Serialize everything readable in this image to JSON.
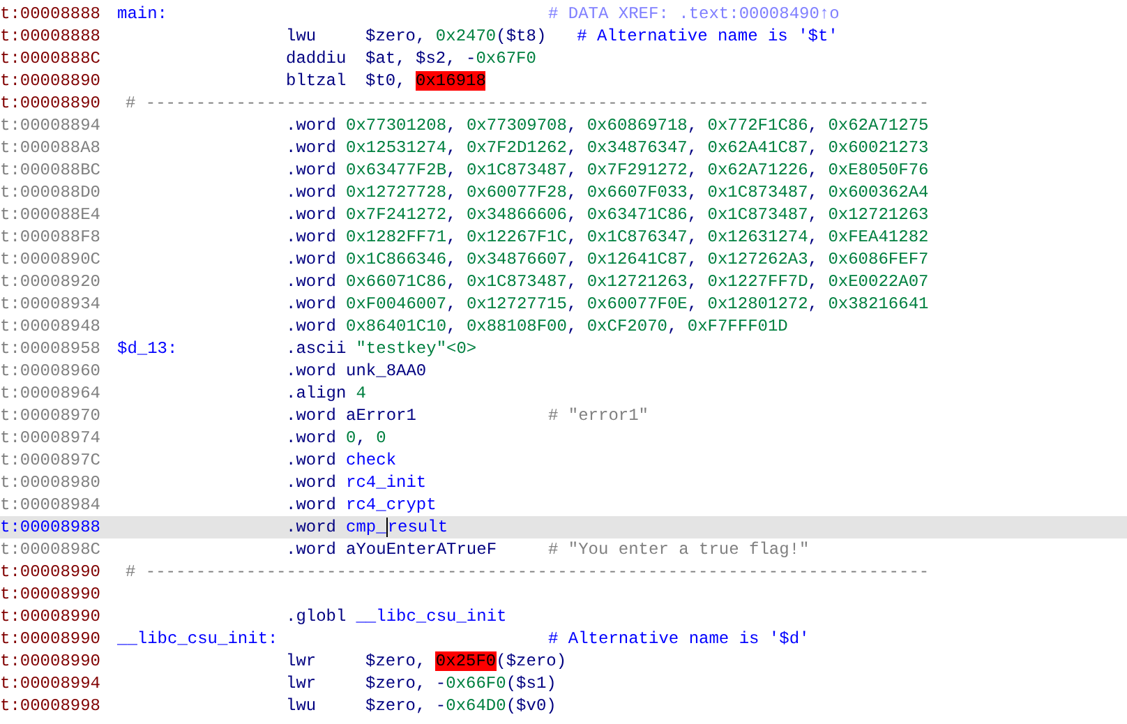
{
  "listing": {
    "rows": [
      {
        "address": "t:00008888",
        "in_code": true,
        "selected": false,
        "kind": "instr",
        "label": "main:",
        "comment": {
          "text": "# DATA XREF: .text:00008490↑o",
          "kind": "xref"
        }
      },
      {
        "address": "t:00008888",
        "in_code": true,
        "selected": false,
        "kind": "instr",
        "mnemonic": "lwu",
        "operands": [
          {
            "text": "$zero",
            "kind": "reg"
          },
          {
            "text": ", ",
            "kind": "punct"
          },
          {
            "text": "0x2470",
            "kind": "num"
          },
          {
            "text": "($t8)",
            "kind": "reg"
          }
        ],
        "comment": {
          "text": "# Alternative name is '$t'",
          "kind": "alt"
        }
      },
      {
        "address": "t:0000888C",
        "in_code": true,
        "selected": false,
        "kind": "instr",
        "mnemonic": "daddiu",
        "operands": [
          {
            "text": "$at",
            "kind": "reg"
          },
          {
            "text": ", ",
            "kind": "punct"
          },
          {
            "text": "$s2",
            "kind": "reg"
          },
          {
            "text": ", -",
            "kind": "punct"
          },
          {
            "text": "0x67F0",
            "kind": "num"
          }
        ]
      },
      {
        "address": "t:00008890",
        "in_code": true,
        "selected": false,
        "kind": "instr",
        "mnemonic": "bltzal",
        "operands": [
          {
            "text": "$t0",
            "kind": "reg"
          },
          {
            "text": ", ",
            "kind": "punct"
          },
          {
            "text": "0x16918",
            "kind": "err"
          }
        ]
      },
      {
        "address": "t:00008890",
        "in_code": true,
        "selected": false,
        "kind": "separator",
        "separator": "# ------------------------------------------------------------------------------"
      },
      {
        "address": "t:00008894",
        "in_code": false,
        "selected": false,
        "kind": "directive",
        "mnemonic": ".word",
        "operands": [
          {
            "text": "0x77301208",
            "kind": "num"
          },
          {
            "text": ", ",
            "kind": "punct"
          },
          {
            "text": "0x77309708",
            "kind": "num"
          },
          {
            "text": ", ",
            "kind": "punct"
          },
          {
            "text": "0x60869718",
            "kind": "num"
          },
          {
            "text": ", ",
            "kind": "punct"
          },
          {
            "text": "0x772F1C86",
            "kind": "num"
          },
          {
            "text": ", ",
            "kind": "punct"
          },
          {
            "text": "0x62A71275",
            "kind": "num"
          }
        ]
      },
      {
        "address": "t:000088A8",
        "in_code": false,
        "selected": false,
        "kind": "directive",
        "mnemonic": ".word",
        "operands": [
          {
            "text": "0x12531274",
            "kind": "num"
          },
          {
            "text": ", ",
            "kind": "punct"
          },
          {
            "text": "0x7F2D1262",
            "kind": "num"
          },
          {
            "text": ", ",
            "kind": "punct"
          },
          {
            "text": "0x34876347",
            "kind": "num"
          },
          {
            "text": ", ",
            "kind": "punct"
          },
          {
            "text": "0x62A41C87",
            "kind": "num"
          },
          {
            "text": ", ",
            "kind": "punct"
          },
          {
            "text": "0x60021273",
            "kind": "num"
          }
        ]
      },
      {
        "address": "t:000088BC",
        "in_code": false,
        "selected": false,
        "kind": "directive",
        "mnemonic": ".word",
        "operands": [
          {
            "text": "0x63477F2B",
            "kind": "num"
          },
          {
            "text": ", ",
            "kind": "punct"
          },
          {
            "text": "0x1C873487",
            "kind": "num"
          },
          {
            "text": ", ",
            "kind": "punct"
          },
          {
            "text": "0x7F291272",
            "kind": "num"
          },
          {
            "text": ", ",
            "kind": "punct"
          },
          {
            "text": "0x62A71226",
            "kind": "num"
          },
          {
            "text": ", ",
            "kind": "punct"
          },
          {
            "text": "0xE8050F76",
            "kind": "num"
          }
        ]
      },
      {
        "address": "t:000088D0",
        "in_code": false,
        "selected": false,
        "kind": "directive",
        "mnemonic": ".word",
        "operands": [
          {
            "text": "0x12727728",
            "kind": "num"
          },
          {
            "text": ", ",
            "kind": "punct"
          },
          {
            "text": "0x60077F28",
            "kind": "num"
          },
          {
            "text": ", ",
            "kind": "punct"
          },
          {
            "text": "0x6607F033",
            "kind": "num"
          },
          {
            "text": ", ",
            "kind": "punct"
          },
          {
            "text": "0x1C873487",
            "kind": "num"
          },
          {
            "text": ", ",
            "kind": "punct"
          },
          {
            "text": "0x600362A4",
            "kind": "num"
          }
        ]
      },
      {
        "address": "t:000088E4",
        "in_code": false,
        "selected": false,
        "kind": "directive",
        "mnemonic": ".word",
        "operands": [
          {
            "text": "0x7F241272",
            "kind": "num"
          },
          {
            "text": ", ",
            "kind": "punct"
          },
          {
            "text": "0x34866606",
            "kind": "num"
          },
          {
            "text": ", ",
            "kind": "punct"
          },
          {
            "text": "0x63471C86",
            "kind": "num"
          },
          {
            "text": ", ",
            "kind": "punct"
          },
          {
            "text": "0x1C873487",
            "kind": "num"
          },
          {
            "text": ", ",
            "kind": "punct"
          },
          {
            "text": "0x12721263",
            "kind": "num"
          }
        ]
      },
      {
        "address": "t:000088F8",
        "in_code": false,
        "selected": false,
        "kind": "directive",
        "mnemonic": ".word",
        "operands": [
          {
            "text": "0x1282FF71",
            "kind": "num"
          },
          {
            "text": ", ",
            "kind": "punct"
          },
          {
            "text": "0x12267F1C",
            "kind": "num"
          },
          {
            "text": ", ",
            "kind": "punct"
          },
          {
            "text": "0x1C876347",
            "kind": "num"
          },
          {
            "text": ", ",
            "kind": "punct"
          },
          {
            "text": "0x12631274",
            "kind": "num"
          },
          {
            "text": ", ",
            "kind": "punct"
          },
          {
            "text": "0xFEA41282",
            "kind": "num"
          }
        ]
      },
      {
        "address": "t:0000890C",
        "in_code": false,
        "selected": false,
        "kind": "directive",
        "mnemonic": ".word",
        "operands": [
          {
            "text": "0x1C866346",
            "kind": "num"
          },
          {
            "text": ", ",
            "kind": "punct"
          },
          {
            "text": "0x34876607",
            "kind": "num"
          },
          {
            "text": ", ",
            "kind": "punct"
          },
          {
            "text": "0x12641C87",
            "kind": "num"
          },
          {
            "text": ", ",
            "kind": "punct"
          },
          {
            "text": "0x127262A3",
            "kind": "num"
          },
          {
            "text": ", ",
            "kind": "punct"
          },
          {
            "text": "0x6086FEF7",
            "kind": "num"
          }
        ]
      },
      {
        "address": "t:00008920",
        "in_code": false,
        "selected": false,
        "kind": "directive",
        "mnemonic": ".word",
        "operands": [
          {
            "text": "0x66071C86",
            "kind": "num"
          },
          {
            "text": ", ",
            "kind": "punct"
          },
          {
            "text": "0x1C873487",
            "kind": "num"
          },
          {
            "text": ", ",
            "kind": "punct"
          },
          {
            "text": "0x12721263",
            "kind": "num"
          },
          {
            "text": ", ",
            "kind": "punct"
          },
          {
            "text": "0x1227FF7D",
            "kind": "num"
          },
          {
            "text": ", ",
            "kind": "punct"
          },
          {
            "text": "0xE0022A07",
            "kind": "num"
          }
        ]
      },
      {
        "address": "t:00008934",
        "in_code": false,
        "selected": false,
        "kind": "directive",
        "mnemonic": ".word",
        "operands": [
          {
            "text": "0xF0046007",
            "kind": "num"
          },
          {
            "text": ", ",
            "kind": "punct"
          },
          {
            "text": "0x12727715",
            "kind": "num"
          },
          {
            "text": ", ",
            "kind": "punct"
          },
          {
            "text": "0x60077F0E",
            "kind": "num"
          },
          {
            "text": ", ",
            "kind": "punct"
          },
          {
            "text": "0x12801272",
            "kind": "num"
          },
          {
            "text": ", ",
            "kind": "punct"
          },
          {
            "text": "0x38216641",
            "kind": "num"
          }
        ]
      },
      {
        "address": "t:00008948",
        "in_code": false,
        "selected": false,
        "kind": "directive",
        "mnemonic": ".word",
        "operands": [
          {
            "text": "0x86401C10",
            "kind": "num"
          },
          {
            "text": ", ",
            "kind": "punct"
          },
          {
            "text": "0x88108F00",
            "kind": "num"
          },
          {
            "text": ", ",
            "kind": "punct"
          },
          {
            "text": "0xCF2070",
            "kind": "num"
          },
          {
            "text": ", ",
            "kind": "punct"
          },
          {
            "text": "0xF7FFF01D",
            "kind": "num"
          }
        ]
      },
      {
        "address": "t:00008958",
        "in_code": false,
        "selected": false,
        "kind": "directive",
        "label": "$d_13:",
        "mnemonic": ".ascii",
        "operands": [
          {
            "text": "\"testkey\"<0>",
            "kind": "str"
          }
        ]
      },
      {
        "address": "t:00008960",
        "in_code": false,
        "selected": false,
        "kind": "directive",
        "mnemonic": ".word",
        "operands": [
          {
            "text": "unk_8AA0",
            "kind": "sym"
          }
        ]
      },
      {
        "address": "t:00008964",
        "in_code": false,
        "selected": false,
        "kind": "directive",
        "mnemonic": ".align",
        "operands": [
          {
            "text": "4",
            "kind": "num"
          }
        ]
      },
      {
        "address": "t:00008970",
        "in_code": false,
        "selected": false,
        "kind": "directive",
        "mnemonic": ".word",
        "operands": [
          {
            "text": "aError1",
            "kind": "sym"
          }
        ],
        "comment": {
          "text": "# \"error1\"",
          "kind": "string"
        }
      },
      {
        "address": "t:00008974",
        "in_code": false,
        "selected": false,
        "kind": "directive",
        "mnemonic": ".word",
        "operands": [
          {
            "text": "0",
            "kind": "num"
          },
          {
            "text": ", ",
            "kind": "punct"
          },
          {
            "text": "0",
            "kind": "num"
          }
        ]
      },
      {
        "address": "t:0000897C",
        "in_code": false,
        "selected": false,
        "kind": "directive",
        "mnemonic": ".word",
        "operands": [
          {
            "text": "check",
            "kind": "func"
          }
        ]
      },
      {
        "address": "t:00008980",
        "in_code": false,
        "selected": false,
        "kind": "directive",
        "mnemonic": ".word",
        "operands": [
          {
            "text": "rc4_init",
            "kind": "func"
          }
        ]
      },
      {
        "address": "t:00008984",
        "in_code": false,
        "selected": false,
        "kind": "directive",
        "mnemonic": ".word",
        "operands": [
          {
            "text": "rc4_crypt",
            "kind": "func"
          }
        ]
      },
      {
        "address": "t:00008988",
        "in_code": false,
        "selected": true,
        "kind": "directive",
        "mnemonic": ".word",
        "operands": [
          {
            "text": "cmp_",
            "kind": "func"
          },
          {
            "text": "result",
            "kind": "caret"
          }
        ]
      },
      {
        "address": "t:0000898C",
        "in_code": false,
        "selected": false,
        "kind": "directive",
        "mnemonic": ".word",
        "operands": [
          {
            "text": "aYouEnterATrueF",
            "kind": "sym"
          }
        ],
        "comment": {
          "text": "# \"You enter a true flag!\"",
          "kind": "string"
        }
      },
      {
        "address": "t:00008990",
        "in_code": true,
        "selected": false,
        "kind": "separator",
        "separator": "# ------------------------------------------------------------------------------"
      },
      {
        "address": "t:00008990",
        "in_code": true,
        "selected": false,
        "kind": "blank"
      },
      {
        "address": "t:00008990",
        "in_code": true,
        "selected": false,
        "kind": "directive",
        "mnemonic": ".globl",
        "operands": [
          {
            "text": "__libc_csu_init",
            "kind": "func"
          }
        ]
      },
      {
        "address": "t:00008990",
        "in_code": true,
        "selected": false,
        "kind": "instr",
        "label": "__libc_csu_init:",
        "comment": {
          "text": "# Alternative name is '$d'",
          "kind": "alt"
        }
      },
      {
        "address": "t:00008990",
        "in_code": true,
        "selected": false,
        "kind": "instr",
        "mnemonic": "lwr",
        "operands": [
          {
            "text": "$zero",
            "kind": "reg"
          },
          {
            "text": ", ",
            "kind": "punct"
          },
          {
            "text": "0x25F0",
            "kind": "err"
          },
          {
            "text": "($zero)",
            "kind": "reg"
          }
        ]
      },
      {
        "address": "t:00008994",
        "in_code": true,
        "selected": false,
        "kind": "instr",
        "mnemonic": "lwr",
        "operands": [
          {
            "text": "$zero",
            "kind": "reg"
          },
          {
            "text": ", -",
            "kind": "punct"
          },
          {
            "text": "0x66F0",
            "kind": "num"
          },
          {
            "text": "($s1)",
            "kind": "reg"
          }
        ]
      },
      {
        "address": "t:00008998",
        "in_code": true,
        "selected": false,
        "kind": "instr",
        "mnemonic": "lwu",
        "operands": [
          {
            "text": "$zero",
            "kind": "reg"
          },
          {
            "text": ", -",
            "kind": "punct"
          },
          {
            "text": "0x64D0",
            "kind": "num"
          },
          {
            "text": "($v0)",
            "kind": "reg"
          }
        ]
      }
    ]
  }
}
